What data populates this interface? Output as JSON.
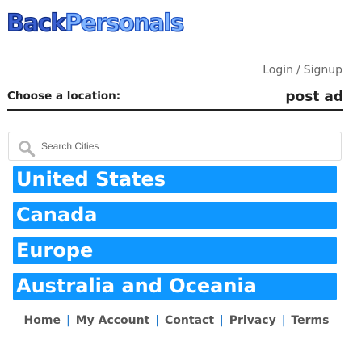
{
  "brand": {
    "logo_part1": "Back",
    "logo_part2": "Personals"
  },
  "header": {
    "login_label": "Login",
    "divider": "/",
    "signup_label": "Signup"
  },
  "location_bar": {
    "choose_label": "Choose a location:",
    "post_ad_label": "post ad"
  },
  "search": {
    "placeholder": "Search Cities",
    "value": ""
  },
  "regions": [
    {
      "label": "United States"
    },
    {
      "label": "Canada"
    },
    {
      "label": "Europe"
    },
    {
      "label": "Australia and Oceania"
    }
  ],
  "footer": {
    "separator": "|",
    "links": [
      "Home",
      "My Account",
      "Contact",
      "Privacy",
      "Terms"
    ]
  },
  "colors": {
    "accent": "#0f97ff",
    "logo_dark": "#1a3fa0",
    "logo_light": "#7fb4ff",
    "footer_separator": "#1a75c9"
  },
  "icons": {
    "search": "search-icon"
  }
}
